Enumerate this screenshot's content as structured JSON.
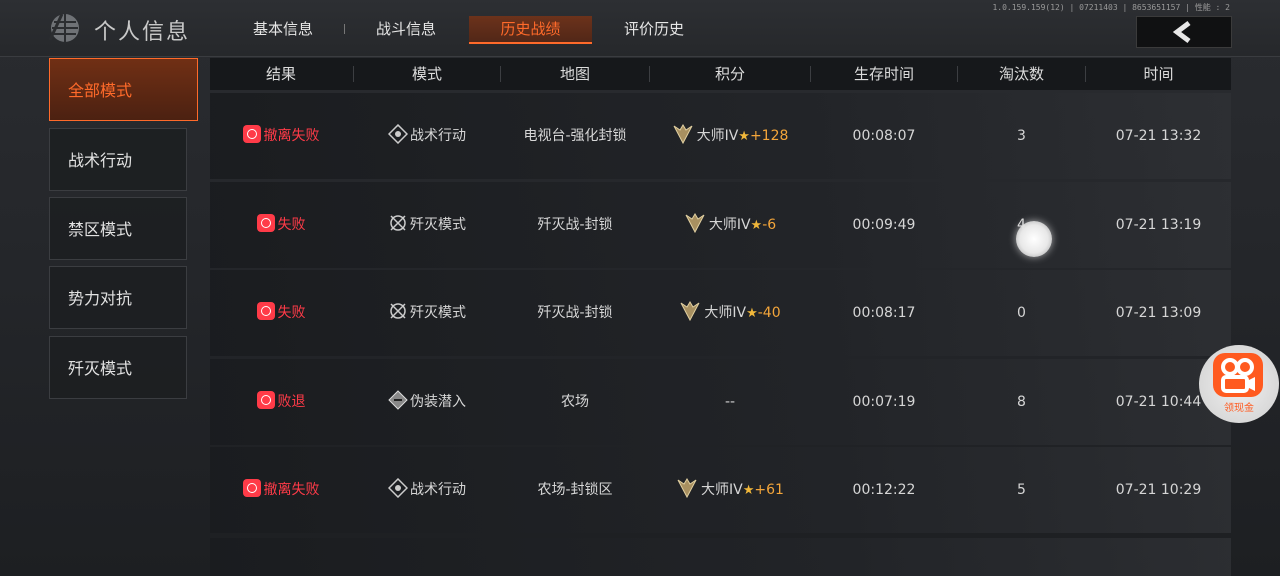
{
  "header": {
    "title": "个人信息",
    "tabs": [
      "基本信息",
      "战斗信息",
      "历史战绩",
      "评价历史"
    ],
    "active_tab": "历史战绩",
    "debug_text": "1.0.159.159(12) | 07211403 | 8653651157 | 性能 : 2"
  },
  "sidebar": {
    "items": [
      "全部模式",
      "战术行动",
      "禁区模式",
      "势力对抗",
      "歼灭模式"
    ],
    "active": "全部模式"
  },
  "table": {
    "columns": [
      "结果",
      "模式",
      "地图",
      "积分",
      "生存时间",
      "淘汰数",
      "时间"
    ],
    "rows": [
      {
        "result": "撤离失败",
        "mode": "战术行动",
        "map": "电视台-强化封锁",
        "rank": "大师IV",
        "delta": "+128",
        "survive": "00:08:07",
        "kills": "3",
        "time": "07-21 13:32"
      },
      {
        "result": "失败",
        "mode": "歼灭模式",
        "map": "歼灭战-封锁",
        "rank": "大师IV",
        "delta": "-6",
        "survive": "00:09:49",
        "kills": "4",
        "time": "07-21 13:19"
      },
      {
        "result": "失败",
        "mode": "歼灭模式",
        "map": "歼灭战-封锁",
        "rank": "大师IV",
        "delta": "-40",
        "survive": "00:08:17",
        "kills": "0",
        "time": "07-21 13:09"
      },
      {
        "result": "败退",
        "mode": "伪装潜入",
        "map": "农场",
        "rank": "",
        "delta": "--",
        "survive": "00:07:19",
        "kills": "8",
        "time": "07-21 10:44"
      },
      {
        "result": "撤离失败",
        "mode": "战术行动",
        "map": "农场-封锁区",
        "rank": "大师IV",
        "delta": "+61",
        "survive": "00:12:22",
        "kills": "5",
        "time": "07-21 10:29"
      }
    ]
  },
  "floating_button": {
    "label": "领现金"
  },
  "colors": {
    "accent": "#ff6a2a",
    "fail": "#ff3b48",
    "score": "#f3a53a"
  }
}
